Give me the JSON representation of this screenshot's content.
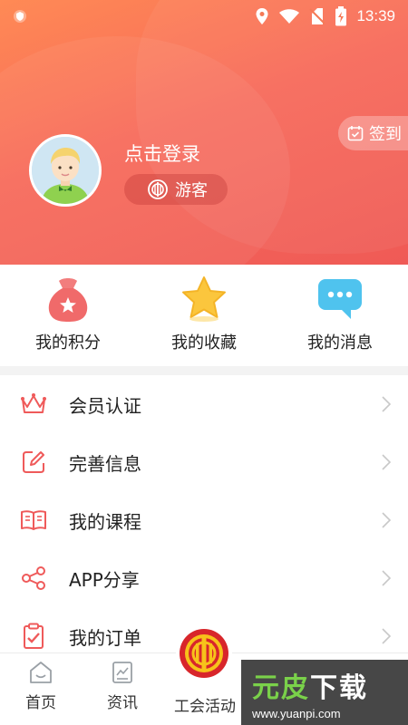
{
  "status_bar": {
    "time": "13:39"
  },
  "profile": {
    "login_text": "点击登录",
    "guest_label": "游客",
    "checkin_label": "签到"
  },
  "quick_actions": [
    {
      "label": "我的积分",
      "icon": "money-bag-icon"
    },
    {
      "label": "我的收藏",
      "icon": "star-icon"
    },
    {
      "label": "我的消息",
      "icon": "chat-bubble-icon"
    }
  ],
  "menu": [
    {
      "label": "会员认证",
      "icon": "crown-icon"
    },
    {
      "label": "完善信息",
      "icon": "edit-icon"
    },
    {
      "label": "我的课程",
      "icon": "book-icon"
    },
    {
      "label": "APP分享",
      "icon": "share-icon"
    },
    {
      "label": "我的订单",
      "icon": "clipboard-icon"
    }
  ],
  "bottom_nav": [
    {
      "label": "首页",
      "icon": "home-icon"
    },
    {
      "label": "资讯",
      "icon": "news-icon"
    },
    {
      "label": "工会活动",
      "icon": "union-emblem-icon"
    }
  ],
  "watermark": {
    "brand_green": "元皮",
    "brand_white": "下载",
    "url": "www.yuanpi.com"
  },
  "colors": {
    "accent": "#f0625a",
    "header_start": "#ff8a55",
    "header_end": "#ef5a56"
  }
}
